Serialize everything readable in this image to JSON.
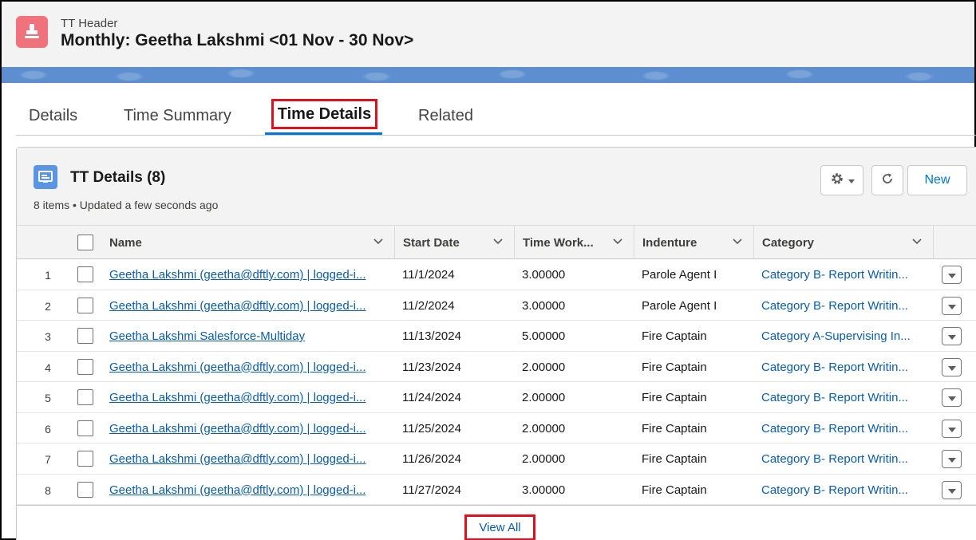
{
  "header": {
    "subtitle": "TT Header",
    "title": "Monthly: Geetha Lakshmi <01 Nov - 30 Nov>",
    "icon": "stamp-icon",
    "icon_color": "#f0727a"
  },
  "tabs": [
    {
      "label": "Details"
    },
    {
      "label": "Time Summary"
    },
    {
      "label": "Time Details",
      "active": true
    },
    {
      "label": "Related"
    }
  ],
  "card": {
    "title": "TT Details (8)",
    "meta": "8 items • Updated a few seconds ago",
    "new_label": "New",
    "columns": [
      "Name",
      "Start Date",
      "Time Work...",
      "Indenture",
      "Category"
    ],
    "rows": [
      {
        "num": "1",
        "name": "Geetha Lakshmi (geetha@dftly.com) | logged-i...",
        "start": "11/1/2024",
        "time": "3.00000",
        "indenture": "Parole Agent I",
        "category": "Category B- Report Writin..."
      },
      {
        "num": "2",
        "name": "Geetha Lakshmi (geetha@dftly.com) | logged-i...",
        "start": "11/2/2024",
        "time": "3.00000",
        "indenture": "Parole Agent I",
        "category": "Category B- Report Writin..."
      },
      {
        "num": "3",
        "name": "Geetha Lakshmi Salesforce-Multiday",
        "start": "11/13/2024",
        "time": "5.00000",
        "indenture": "Fire Captain",
        "category": "Category A-Supervising In..."
      },
      {
        "num": "4",
        "name": "Geetha Lakshmi (geetha@dftly.com) | logged-i...",
        "start": "11/23/2024",
        "time": "2.00000",
        "indenture": "Fire Captain",
        "category": "Category B- Report Writin..."
      },
      {
        "num": "5",
        "name": "Geetha Lakshmi (geetha@dftly.com) | logged-i...",
        "start": "11/24/2024",
        "time": "2.00000",
        "indenture": "Fire Captain",
        "category": "Category B- Report Writin..."
      },
      {
        "num": "6",
        "name": "Geetha Lakshmi (geetha@dftly.com) | logged-i...",
        "start": "11/25/2024",
        "time": "2.00000",
        "indenture": "Fire Captain",
        "category": "Category B- Report Writin..."
      },
      {
        "num": "7",
        "name": "Geetha Lakshmi (geetha@dftly.com) | logged-i...",
        "start": "11/26/2024",
        "time": "2.00000",
        "indenture": "Fire Captain",
        "category": "Category B- Report Writin..."
      },
      {
        "num": "8",
        "name": "Geetha Lakshmi (geetha@dftly.com) | logged-i...",
        "start": "11/27/2024",
        "time": "3.00000",
        "indenture": "Fire Captain",
        "category": "Category B- Report Writin..."
      }
    ],
    "view_all": "View All"
  },
  "colors": {
    "link": "#0b5cab",
    "accent": "#0176d3",
    "highlight": "#e0101c",
    "card_icon": "#5a95e5"
  }
}
